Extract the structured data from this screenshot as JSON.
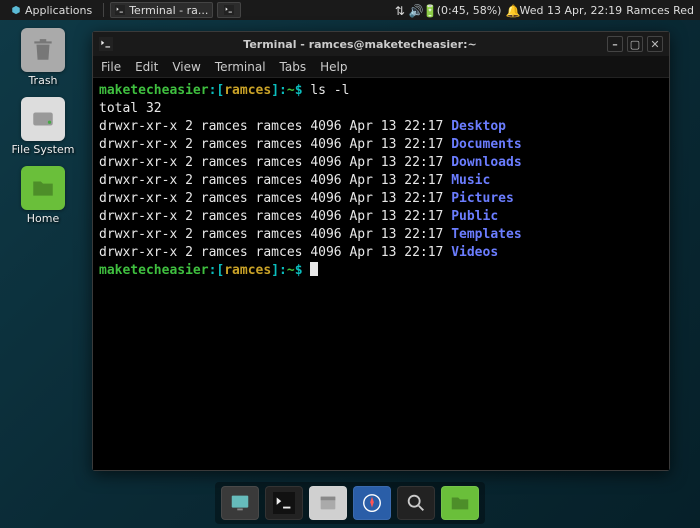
{
  "panel": {
    "applications": "Applications",
    "task_label": "Terminal - ra...",
    "battery": "(0:45, 58%)",
    "date": "Wed 13 Apr, 22:19",
    "user": "Ramces Red"
  },
  "desktop": {
    "trash": "Trash",
    "filesystem": "File System",
    "home": "Home"
  },
  "window": {
    "title": "Terminal - ramces@maketecheasier:~",
    "menu": {
      "file": "File",
      "edit": "Edit",
      "view": "View",
      "terminal": "Terminal",
      "tabs": "Tabs",
      "help": "Help"
    }
  },
  "term": {
    "host": "maketecheasier",
    "user": "ramces",
    "sep1": ":[",
    "sep2": "]:",
    "tilde": "~",
    "dollar": "$",
    "cmd": "ls -l",
    "total": "total 32",
    "rows": [
      {
        "meta": "drwxr-xr-x 2 ramces ramces 4096 Apr 13 22:17 ",
        "name": "Desktop"
      },
      {
        "meta": "drwxr-xr-x 2 ramces ramces 4096 Apr 13 22:17 ",
        "name": "Documents"
      },
      {
        "meta": "drwxr-xr-x 2 ramces ramces 4096 Apr 13 22:17 ",
        "name": "Downloads"
      },
      {
        "meta": "drwxr-xr-x 2 ramces ramces 4096 Apr 13 22:17 ",
        "name": "Music"
      },
      {
        "meta": "drwxr-xr-x 2 ramces ramces 4096 Apr 13 22:17 ",
        "name": "Pictures"
      },
      {
        "meta": "drwxr-xr-x 2 ramces ramces 4096 Apr 13 22:17 ",
        "name": "Public"
      },
      {
        "meta": "drwxr-xr-x 2 ramces ramces 4096 Apr 13 22:17 ",
        "name": "Templates"
      },
      {
        "meta": "drwxr-xr-x 2 ramces ramces 4096 Apr 13 22:17 ",
        "name": "Videos"
      }
    ]
  }
}
